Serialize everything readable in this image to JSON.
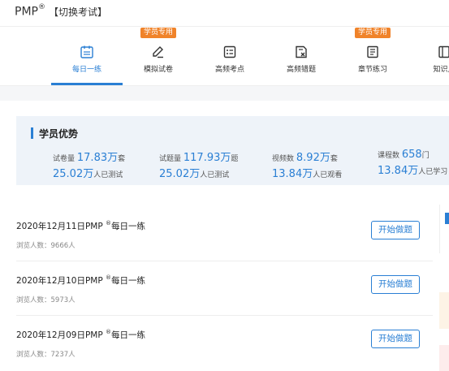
{
  "header": {
    "brand": "PMP",
    "brand_sup": "®",
    "switch_label": "【切换考试】"
  },
  "tabs": [
    {
      "label": "每日一练",
      "badge": "",
      "icon": "calendar-icon",
      "active": true
    },
    {
      "label": "模拟试卷",
      "badge": "学员专用",
      "icon": "pen-icon",
      "active": false
    },
    {
      "label": "高频考点",
      "badge": "",
      "icon": "list-icon",
      "active": false
    },
    {
      "label": "高频错题",
      "badge": "",
      "icon": "doc-x-icon",
      "active": false
    },
    {
      "label": "章节练习",
      "badge": "学员专用",
      "icon": "book-icon",
      "active": false
    },
    {
      "label": "知识点",
      "badge": "",
      "icon": "knowledge-icon",
      "active": false
    }
  ],
  "advantage": {
    "title": "学员优势",
    "stats": [
      {
        "l1_prefix": "试卷量",
        "l1_num": "17.83万",
        "l1_suffix": "套",
        "l2_num": "25.02万",
        "l2_suffix": "人已测试"
      },
      {
        "l1_prefix": "试题量",
        "l1_num": "117.93万",
        "l1_suffix": "题",
        "l2_num": "25.02万",
        "l2_suffix": "人已测试"
      },
      {
        "l1_prefix": "视频数",
        "l1_num": "8.92万",
        "l1_suffix": "套",
        "l2_num": "13.84万",
        "l2_suffix": "人已观看"
      },
      {
        "l1_prefix": "课程数",
        "l1_num": "658",
        "l1_suffix": "门",
        "l2_num": "13.84万",
        "l2_suffix": "人已学习"
      }
    ]
  },
  "practice_list": [
    {
      "title_pre": "2020年12月11日PMP ",
      "title_sup": "®",
      "title_post": "每日一练",
      "views": "浏览人数：9666人",
      "button": "开始做题"
    },
    {
      "title_pre": "2020年12月10日PMP ",
      "title_sup": "®",
      "title_post": "每日一练",
      "views": "浏览人数：5973人",
      "button": "开始做题"
    },
    {
      "title_pre": "2020年12月09日PMP ",
      "title_sup": "®",
      "title_post": "每日一练",
      "views": "浏览人数：7237人",
      "button": "开始做题"
    }
  ],
  "colors": {
    "accent": "#2a7fd4",
    "badge": "#f0832a",
    "panel": "#eef3f9"
  }
}
